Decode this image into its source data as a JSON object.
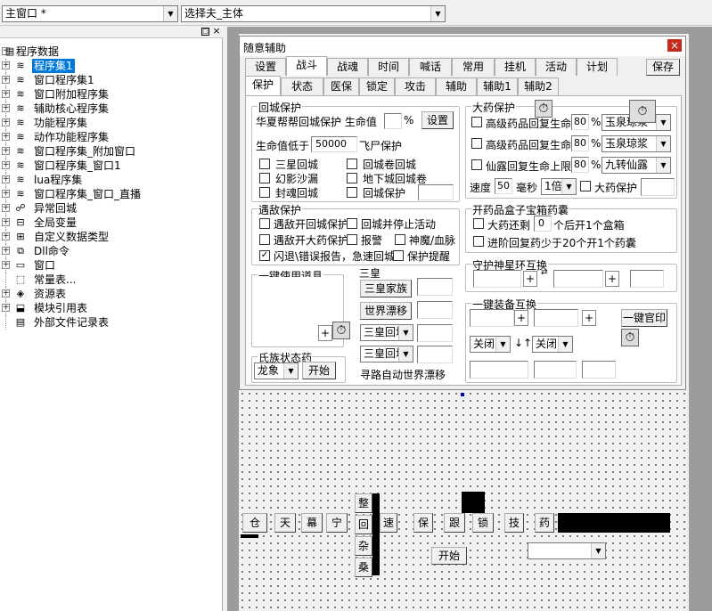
{
  "toolbar": {
    "window_combo": "主窗口 *",
    "type_combo": "选择夫_主体"
  },
  "tree": {
    "root": "程序数据",
    "items": [
      "程序集1",
      "窗口程序集1",
      "窗口附加程序集",
      "辅助核心程序集",
      "功能程序集",
      "动作功能程序集",
      "窗口程序集_附加窗口",
      "窗口程序集_窗口1",
      "lua程序集",
      "窗口程序集_窗口_直播",
      "异常回城",
      "全局变量",
      "自定义数据类型",
      "Dll命令",
      "窗口",
      "常量表...",
      "资源表",
      "模块引用表",
      "外部文件记录表"
    ]
  },
  "dialog": {
    "title": "随意辅助",
    "close": "×",
    "tabs_row1": [
      "设置",
      "战斗",
      "战魂",
      "时间",
      "喊话",
      "常用",
      "挂机",
      "活动",
      "计划"
    ],
    "save": "保存",
    "tabs_row2": [
      "保护",
      "状态",
      "医保",
      "锁定",
      "攻击",
      "辅助",
      "辅助1",
      "辅助2"
    ],
    "city": {
      "title": "回城保护",
      "line1": "华夏帮帮回城保护 生命值",
      "pct": "%",
      "set": "设置",
      "hp_label": "生命值低于",
      "hp_value": "50000",
      "fly": "飞尸保护",
      "opts": [
        "三星回城",
        "回城卷回城",
        "幻影沙漏",
        "地下城回城卷",
        "封魂回城",
        "回城保护"
      ]
    },
    "enemy": {
      "title": "遇敌保护",
      "opts": [
        "遇敌开回城保护",
        "回城并停止活动",
        "遇敌开大药保护",
        "报警",
        "神魔/血脉",
        "闪退\\错误报告，急速回城",
        "保护提醒"
      ]
    },
    "bigmed": {
      "title": "大药保护",
      "rows": [
        {
          "label": "高级药品回复生命",
          "val": "80",
          "item": "玉泉琼浆"
        },
        {
          "label": "高级药品回复生命",
          "val": "80",
          "item": "玉泉琼浆"
        },
        {
          "label": "仙露回复生命上限",
          "val": "80",
          "item": "九转仙露"
        }
      ],
      "pct": "%",
      "speed_label": "速度",
      "speed": "50",
      "ms": "毫秒",
      "mult": "1倍",
      "big_protect": "大药保护"
    },
    "box": {
      "title": "开药品盒子宝箱药囊",
      "opt1a": "大药还剩",
      "opt1v": "0",
      "opt1b": "个后开1个盒箱",
      "opt2": "进阶回复药少于20个开1个药囊"
    },
    "guard": {
      "title": "守护神星环互换",
      "plus": "+"
    },
    "equip": {
      "title": "一键装备互换",
      "plus": "+",
      "one_click": "一键官印",
      "off1": "关闭",
      "off2": "关闭"
    },
    "items": {
      "title": "一键使用道具",
      "plus": "+"
    },
    "sanhuang": {
      "title": "三皇",
      "b1": "三皇家族",
      "b2": "世界漂移",
      "c1": "三皇回城",
      "c2": "三皇回城",
      "path": "寻路自动世界漂移"
    },
    "race": {
      "title": "氏族状态药",
      "combo": "龙象",
      "start": "开始"
    }
  },
  "designer": {
    "buttons": [
      "仓",
      "天",
      "幕",
      "宁",
      "速",
      "保",
      "跟",
      "锁",
      "技",
      "药"
    ],
    "vert": [
      "整",
      "回",
      "杂",
      "桑"
    ],
    "start": "开始"
  }
}
